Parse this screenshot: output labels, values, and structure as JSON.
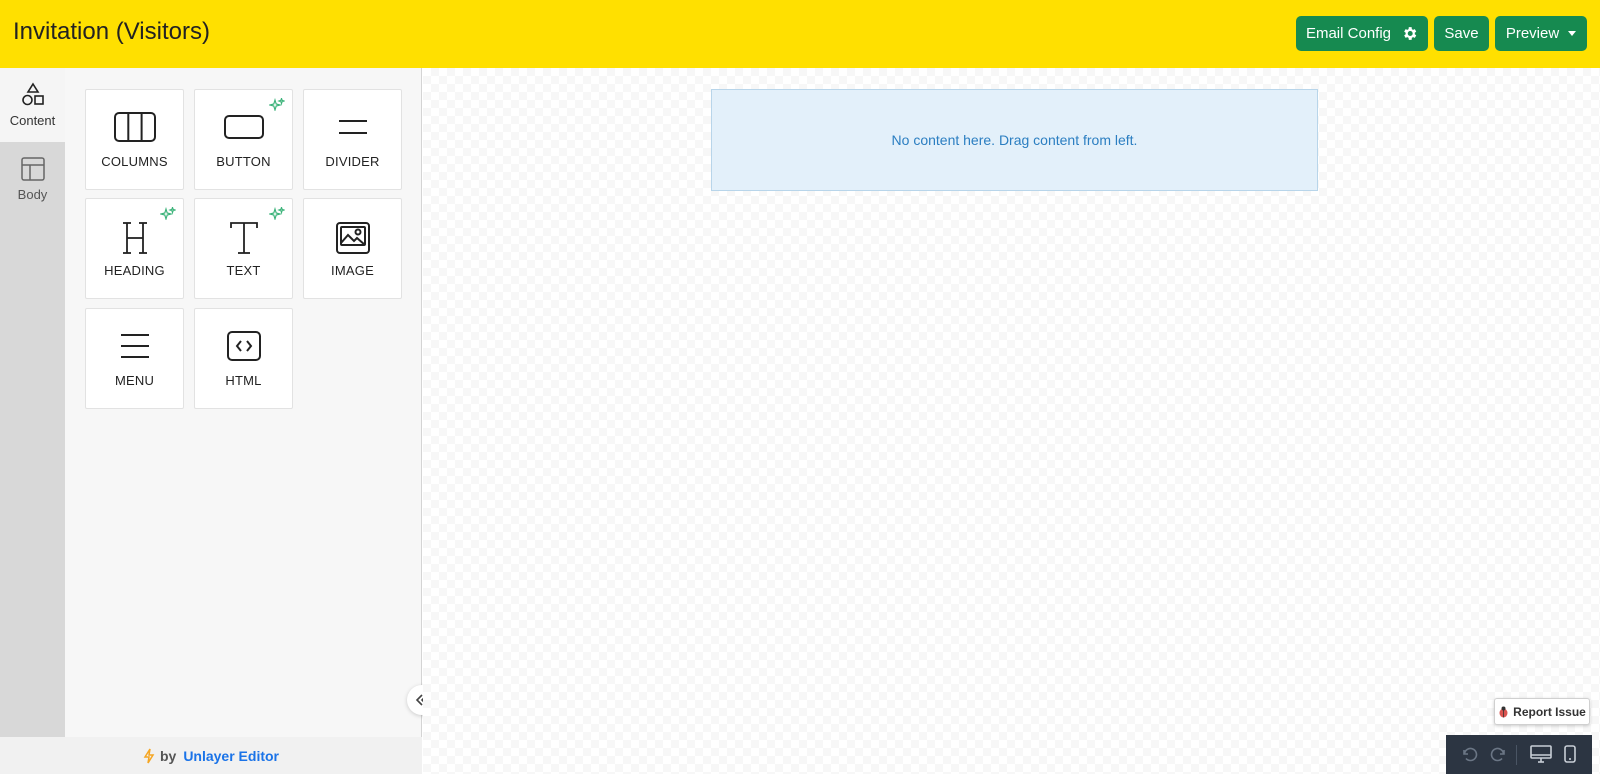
{
  "header": {
    "title": "Invitation (Visitors)",
    "email_config_label": "Email Config",
    "save_label": "Save",
    "preview_label": "Preview",
    "bg_color": "#ffe000",
    "button_color": "#168a50"
  },
  "sidenav": {
    "items": [
      {
        "label": "Content",
        "icon": "shapes-icon",
        "active": true
      },
      {
        "label": "Body",
        "icon": "layout-icon",
        "active": false
      }
    ]
  },
  "tools": [
    {
      "label": "COLUMNS",
      "icon": "columns-icon",
      "ai": false
    },
    {
      "label": "BUTTON",
      "icon": "button-icon",
      "ai": true
    },
    {
      "label": "DIVIDER",
      "icon": "divider-icon",
      "ai": false
    },
    {
      "label": "HEADING",
      "icon": "heading-icon",
      "ai": true
    },
    {
      "label": "TEXT",
      "icon": "text-icon",
      "ai": true
    },
    {
      "label": "IMAGE",
      "icon": "image-icon",
      "ai": false
    },
    {
      "label": "MENU",
      "icon": "menu-icon",
      "ai": false
    },
    {
      "label": "HTML",
      "icon": "code-icon",
      "ai": false
    }
  ],
  "canvas": {
    "empty_message": "No content here. Drag content from left."
  },
  "footer": {
    "by": "by",
    "brand": "Unlayer Editor"
  },
  "report_issue_label": "Report Issue",
  "toolbar": {
    "icons": [
      "undo-icon",
      "redo-icon",
      "desktop-icon",
      "mobile-icon"
    ]
  }
}
